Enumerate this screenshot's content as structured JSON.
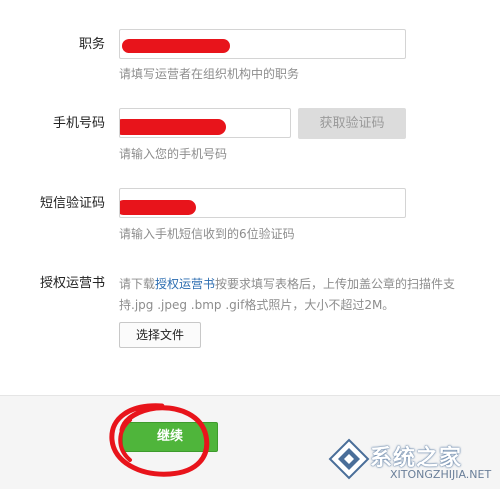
{
  "form": {
    "position": {
      "label": "职务",
      "hint": "请填写运营者在组织机构中的职务"
    },
    "phone": {
      "label": "手机号码",
      "hint": "请输入您的手机号码",
      "code_button": "获取验证码"
    },
    "sms_code": {
      "label": "短信验证码",
      "hint": "请输入手机短信收到的6位验证码"
    },
    "authorization": {
      "label": "授权运营书",
      "text_before": "请下载",
      "link": "授权运营书",
      "text_after": "按要求填写表格后，上传加盖公章的扫描件支持.jpg .jpeg .bmp .gif格式照片，大小不超过2M。",
      "file_button": "选择文件"
    }
  },
  "footer": {
    "continue_label": "继续"
  },
  "watermark": {
    "brand": "系统之家",
    "url": "XITONGZHIJIA.NET"
  },
  "colors": {
    "redaction": "#e8141b",
    "continue": "#4fb53b",
    "link": "#2b6cb0"
  }
}
